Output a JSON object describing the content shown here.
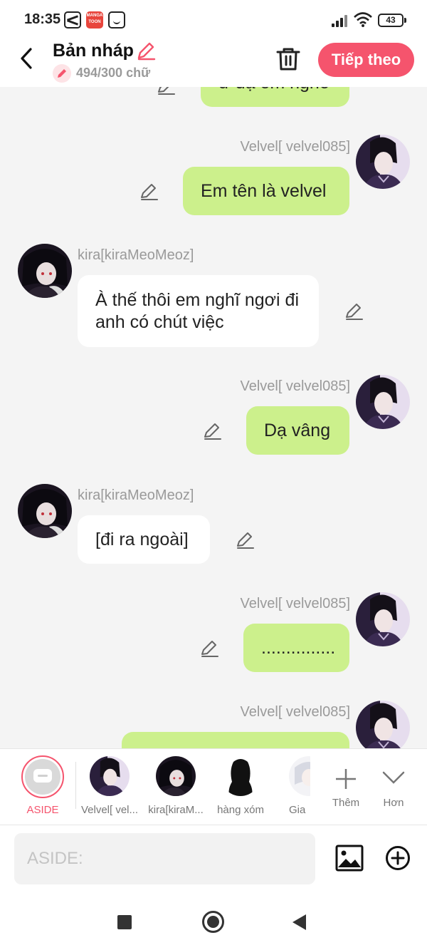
{
  "status_bar": {
    "time": "18:35",
    "battery": "43",
    "app_icon_label": "MANGA TOON"
  },
  "header": {
    "title": "Bản nháp",
    "word_count": "494/300 chữ",
    "next_label": "Tiếp theo"
  },
  "messages": [
    {
      "side": "right",
      "text": "ừ dạ em nghe"
    },
    {
      "side": "right",
      "name": "Velvel[ velvel085]",
      "text": "Em tên là velvel"
    },
    {
      "side": "left",
      "name": "kira[kiraMeoMeoz]",
      "text": "À thế thôi em nghĩ ngơi đi anh có chút việc"
    },
    {
      "side": "right",
      "name": "Velvel[ velvel085]",
      "text": "Dạ vâng"
    },
    {
      "side": "left",
      "name": "kira[kiraMeoMeoz]",
      "text": "[đi ra ngoài]"
    },
    {
      "side": "right",
      "name": "Velvel[ velvel085]",
      "text": "..............."
    },
    {
      "side": "right",
      "name": "Velvel[ velvel085]",
      "text": ""
    }
  ],
  "characters": [
    {
      "label": "ASIDE",
      "selected": true
    },
    {
      "label": "Velvel[ vel..."
    },
    {
      "label": "kira[kiraM..."
    },
    {
      "label": "hàng xóm"
    },
    {
      "label": "Gia"
    },
    {
      "label": "Thêm"
    },
    {
      "label": "Hơn"
    }
  ],
  "input": {
    "placeholder": "ASIDE:"
  },
  "colors": {
    "accent": "#f5546d",
    "right_bubble": "#ccf08c",
    "left_bubble": "#ffffff",
    "background": "#f4f4f4"
  },
  "icons": {
    "back": "chevron-left-icon",
    "title_edit": "pencil-icon",
    "trash": "trash-icon",
    "message_edit": "pencil-icon",
    "add_character": "plus-icon",
    "more": "chevron-down-icon",
    "image": "image-icon",
    "add": "plus-circle-icon"
  }
}
